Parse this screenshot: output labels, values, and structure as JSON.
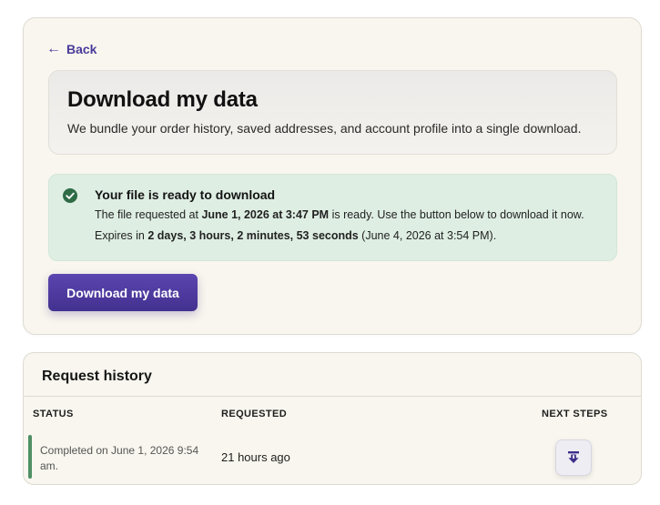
{
  "nav": {
    "back_label": "Back",
    "back_arrow": "←"
  },
  "hero": {
    "title": "Download my data",
    "description": "We bundle your order history, saved addresses, and account profile into a single download."
  },
  "notice": {
    "icon": "check-circle-icon",
    "title": "Your file is ready to download",
    "line1_pre": "The file requested at ",
    "line1_time": "June 1, 2026 at 3:47 PM",
    "line1_post": " is ready. Use the button below to download it now.",
    "line2_pre": "Expires in ",
    "line2_countdown": "2 days, 3 hours, 2 minutes, 53 seconds",
    "line2_post": " (June 4, 2026 at 3:54 PM)."
  },
  "download_button": {
    "label": "Download my data"
  },
  "history": {
    "title": "Request history",
    "columns": {
      "status": "STATUS",
      "requested": "REQUESTED",
      "next_steps": "NEXT STEPS"
    },
    "rows": [
      {
        "status": "Completed on June 1, 2026 9:54 am.",
        "requested": "21 hours ago",
        "next_step_icon": "download-icon"
      }
    ]
  },
  "colors": {
    "accent": "#4a3b9a",
    "button": "#4f3aa3",
    "success_bg": "#deeee3",
    "success_icon": "#2f6b45",
    "row_accent": "#4f8f64",
    "card_bg": "#f8f6ee"
  }
}
